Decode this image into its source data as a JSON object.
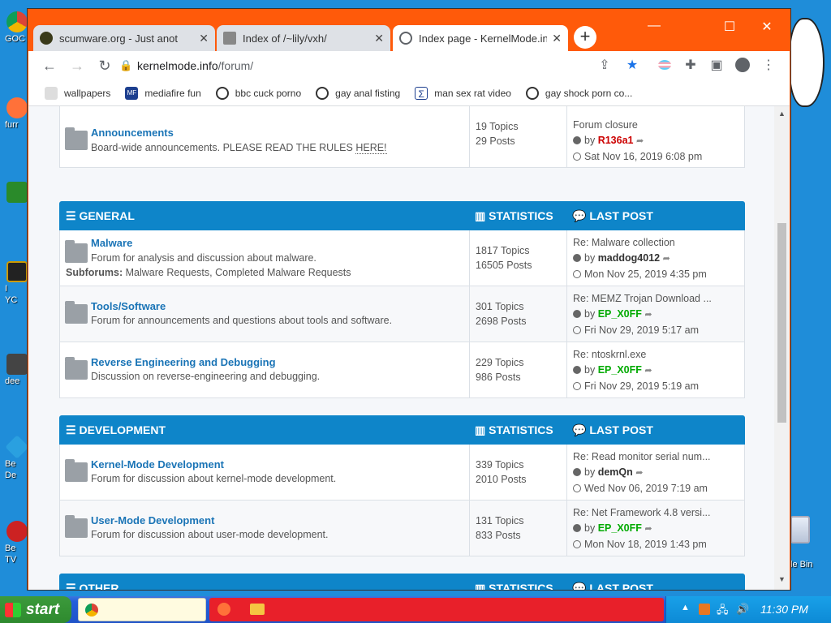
{
  "desktop": {
    "left_labels": [
      "GOC",
      "furr",
      "I",
      "YC",
      "dee",
      "Be",
      "De",
      "Be",
      "TV"
    ],
    "recycle_bin_label": "le Bin"
  },
  "browser": {
    "tabs": [
      {
        "title": "scumware.org - Just anot",
        "active": false
      },
      {
        "title": "Index of /~lily/vxh/",
        "active": false
      },
      {
        "title": "Index page - KernelMode.in",
        "active": true
      }
    ],
    "new_tab": "+",
    "url_host": "kernelmode.info",
    "url_path": "/forum/",
    "bookmarks": [
      "wallpapers",
      "mediafire fun",
      "bbc cuck porno",
      "gay anal fisting",
      "man sex rat video",
      "gay shock porn co..."
    ]
  },
  "forum": {
    "top_row": {
      "title": "Announcements",
      "desc": "Board-wide announcements. PLEASE READ THE RULES",
      "desc_link": "HERE!",
      "topics": "19 Topics",
      "posts": "29 Posts",
      "last_title": "Forum closure",
      "last_by": "by",
      "last_user": "R136a1",
      "last_date": "Sat Nov 16, 2019 6:08 pm",
      "user_color": "#cc0000"
    },
    "stats_label": "STATISTICS",
    "lastpost_label": "LAST POST",
    "categories": [
      {
        "name": "GENERAL",
        "forums": [
          {
            "title": "Malware",
            "desc": "Forum for analysis and discussion about malware.",
            "subforums_label": "Subforums:",
            "subforums": "Malware Requests, Completed Malware Requests",
            "topics": "1817 Topics",
            "posts": "16505 Posts",
            "last_title": "Re: Malware collection",
            "last_by": "by",
            "last_user": "maddog4012",
            "user_color": "#333333",
            "last_date": "Mon Nov 25, 2019 4:35 pm"
          },
          {
            "title": "Tools/Software",
            "desc": "Forum for announcements and questions about tools and software.",
            "topics": "301 Topics",
            "posts": "2698 Posts",
            "last_title": "Re: MEMZ Trojan Download ...",
            "last_by": "by",
            "last_user": "EP_X0FF",
            "user_color": "#00aa00",
            "last_date": "Fri Nov 29, 2019 5:17 am"
          },
          {
            "title": "Reverse Engineering and Debugging",
            "desc": "Discussion on reverse-engineering and debugging.",
            "topics": "229 Topics",
            "posts": "986 Posts",
            "last_title": "Re: ntoskrnl.exe",
            "last_by": "by",
            "last_user": "EP_X0FF",
            "user_color": "#00aa00",
            "last_date": "Fri Nov 29, 2019 5:19 am"
          }
        ]
      },
      {
        "name": "DEVELOPMENT",
        "forums": [
          {
            "title": "Kernel-Mode Development",
            "desc": "Forum for discussion about kernel-mode development.",
            "topics": "339 Topics",
            "posts": "2010 Posts",
            "last_title": "Re: Read monitor serial num...",
            "last_by": "by",
            "last_user": "demQn",
            "user_color": "#333333",
            "last_date": "Wed Nov 06, 2019 7:19 am"
          },
          {
            "title": "User-Mode Development",
            "desc": "Forum for discussion about user-mode development.",
            "topics": "131 Topics",
            "posts": "833 Posts",
            "last_title": "Re: Net Framework 4.8 versi...",
            "last_by": "by",
            "last_user": "EP_X0FF",
            "user_color": "#00aa00",
            "last_date": "Mon Nov 18, 2019 1:43 pm"
          }
        ]
      },
      {
        "name": "OTHER",
        "forums": []
      }
    ]
  },
  "taskbar": {
    "start_label": "start",
    "clock": "11:30 PM"
  }
}
